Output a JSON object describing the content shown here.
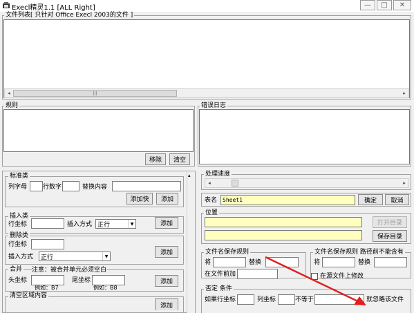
{
  "window": {
    "title": "Execl精灵1.1  [ALL Right]",
    "min": "—",
    "max": "□",
    "close": "✕"
  },
  "file_list": {
    "legend": "文件列表[ 只针对 Office Execl 2003的文件 ]"
  },
  "rules": {
    "legend": "规则",
    "move_btn": "移除",
    "clear_btn": "清空"
  },
  "error_log": {
    "legend": "错误日志"
  },
  "std": {
    "legend": "标准类",
    "col_letter": "列字母",
    "row_num": "行数字",
    "replace_content": "替换内容",
    "add_block": "添加快",
    "add": "添加"
  },
  "insert": {
    "legend": "插入类",
    "row_coord": "行坐标",
    "insert_mode": "插入方式",
    "mode_value": "正行",
    "add": "添加"
  },
  "delete": {
    "legend": "删除类",
    "row_coord": "行坐标",
    "insert_mode": "插入方式",
    "mode_value": "正行",
    "add": "添加"
  },
  "merge": {
    "legend": "合并",
    "note": "注意：被合并单元必须空白",
    "head_coord": "头坐标",
    "tail_coord": "尾坐标",
    "ex1": "例如：B7",
    "ex2": "例如：B8",
    "add": "添加"
  },
  "clear_area": {
    "legend": "清空区域内容",
    "add": "添加"
  },
  "progress": {
    "legend": "处理速度",
    "value": 0.1
  },
  "sheet": {
    "label": "表名",
    "value": "Sheet1",
    "ok": "确定",
    "cancel": "取消"
  },
  "location": {
    "legend": "位置",
    "open_dir": "打开目录",
    "save_dir": "保存目录"
  },
  "save_rule": {
    "legend": "文件名保存规则",
    "from": "将",
    "replace": "替换",
    "prefix": "在文件前加"
  },
  "save_rule2": {
    "legend": "文件名保存规则  路径前不能含有",
    "from": "将",
    "replace": "替换",
    "modify_src": "在源文件上修改"
  },
  "negate": {
    "legend": "否定 条件",
    "if_row": "如果行坐标",
    "col_coord": "列坐标",
    "not_equal": "不等于",
    "ignore": "就忽略该文件"
  },
  "colors": {
    "yellow_input": "#ffffc0",
    "arrow": "#e02020"
  }
}
